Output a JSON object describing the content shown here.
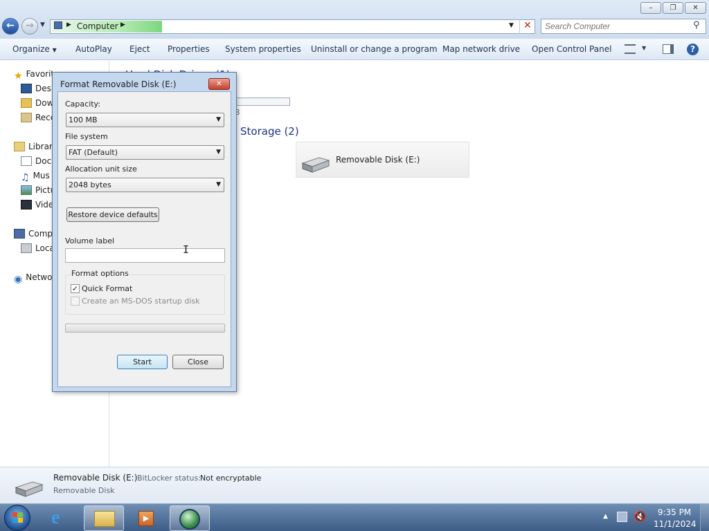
{
  "window": {
    "minimize": "–",
    "maximize": "❐",
    "close": "✕"
  },
  "address": {
    "crumb": "Computer",
    "search_placeholder": "Search Computer"
  },
  "toolbar": {
    "organize": "Organize",
    "autoplay": "AutoPlay",
    "eject": "Eject",
    "properties": "Properties",
    "system_properties": "System properties",
    "uninstall": "Uninstall or change a program",
    "map_drive": "Map network drive",
    "control_panel": "Open Control Panel"
  },
  "nav": {
    "favorites": "Favorit",
    "desktop": "Desk",
    "downloads": "Dow",
    "recent": "Rece",
    "libraries": "Librari",
    "documents": "Docu",
    "music": "Mus",
    "pictures": "Pictu",
    "videos": "Vide",
    "computer": "Comp",
    "local_disk": "Loca",
    "network": "Netwo"
  },
  "content": {
    "hdd_header": "Hard Disk Drives (1)",
    "hdd_size_fragment": "B",
    "removable_header": "Storage (2)",
    "removable_disk": "Removable Disk (E:)"
  },
  "details": {
    "name": "Removable Disk (E:)",
    "bitlocker_label": "BitLocker status:",
    "bitlocker_value": "Not encryptable",
    "type": "Removable Disk"
  },
  "dialog": {
    "title": "Format Removable Disk (E:)",
    "close": "✕",
    "capacity_label": "Capacity:",
    "capacity_value": "100 MB",
    "filesystem_label": "File system",
    "filesystem_value": "FAT (Default)",
    "allocation_label": "Allocation unit size",
    "allocation_value": "2048 bytes",
    "restore_button": "Restore device defaults",
    "volume_label": "Volume label",
    "volume_value": "",
    "format_options": "Format options",
    "quick_format": "Quick Format",
    "quick_format_checked": true,
    "msdos": "Create an MS-DOS startup disk",
    "msdos_checked": false,
    "progress": 0,
    "start_button": "Start",
    "close_button": "Close"
  },
  "tray": {
    "time": "9:35 PM",
    "date": "11/1/2024"
  },
  "colors": {
    "accent": "#3c6196",
    "section_header": "#1e3287"
  }
}
